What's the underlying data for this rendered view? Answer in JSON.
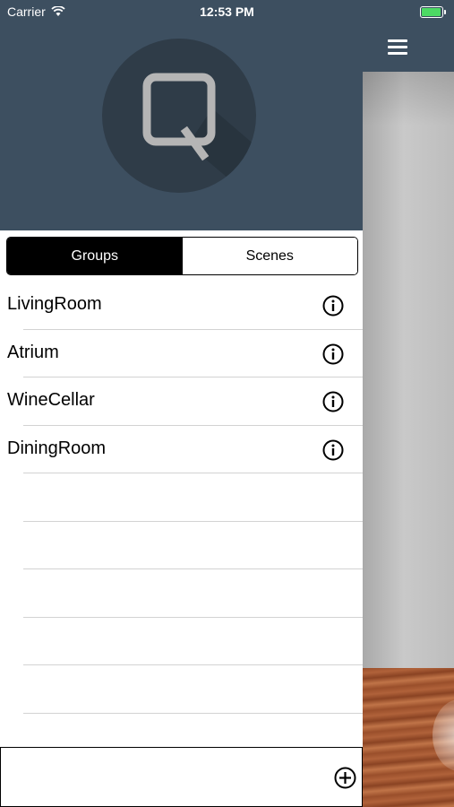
{
  "status_bar": {
    "carrier": "Carrier",
    "time": "12:53 PM",
    "battery_color": "#4cd964"
  },
  "header": {
    "logo_letter": "Q",
    "background_color": "#3d4f60"
  },
  "segments": [
    {
      "label": "Groups",
      "selected": true
    },
    {
      "label": "Scenes",
      "selected": false
    }
  ],
  "groups": [
    {
      "name": "LivingRoom",
      "icon": "info-icon"
    },
    {
      "name": "Atrium",
      "icon": "info-icon"
    },
    {
      "name": "WineCellar",
      "icon": "info-icon"
    },
    {
      "name": "DiningRoom",
      "icon": "info-icon"
    }
  ],
  "empty_rows": 6,
  "footer": {
    "add_icon": "add-circle-icon"
  },
  "menu": {
    "icon": "hamburger-menu-icon"
  }
}
